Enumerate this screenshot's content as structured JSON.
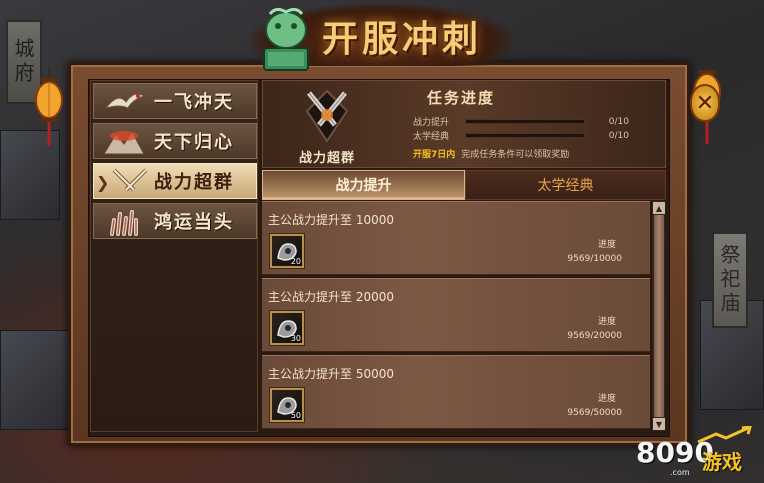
{
  "title": "开服冲刺",
  "left_sign": "城府",
  "right_sign": "祭祀庙",
  "nav": [
    {
      "label": "一飞冲天",
      "active": false,
      "icon": "crane-icon"
    },
    {
      "label": "天下归心",
      "active": false,
      "icon": "mountain-icon"
    },
    {
      "label": "战力超群",
      "active": true,
      "icon": "crossed-swords-icon"
    },
    {
      "label": "鸿运当头",
      "active": false,
      "icon": "coral-icon"
    }
  ],
  "task_panel": {
    "emblem_label": "战力超群",
    "title": "任务进度",
    "progress": [
      {
        "label": "战力提升",
        "value": "0/10",
        "fraction": 0
      },
      {
        "label": "太学经典",
        "value": "0/10",
        "fraction": 0
      }
    ],
    "deadline_highlight": "开服7日内",
    "deadline_text": "完成任务条件可以领取奖励"
  },
  "tabs": [
    {
      "label": "战力提升",
      "active": true
    },
    {
      "label": "太学经典",
      "active": false
    }
  ],
  "tasks": [
    {
      "desc": "主公战力提升至 10000",
      "reward_count": "20",
      "progress_label": "进度",
      "progress_value": "9569/10000"
    },
    {
      "desc": "主公战力提升至 20000",
      "reward_count": "30",
      "progress_label": "进度",
      "progress_value": "9569/20000"
    },
    {
      "desc": "主公战力提升至 50000",
      "reward_count": "50",
      "progress_label": "进度",
      "progress_value": "9569/50000"
    }
  ],
  "logo": {
    "brand": "8090",
    "cn": "游戏",
    "sub": ".com"
  },
  "colors": {
    "accent_gold": "#f3cf7a",
    "deadline_yellow": "#f4c11c",
    "tab_inactive": "#e3a548"
  }
}
